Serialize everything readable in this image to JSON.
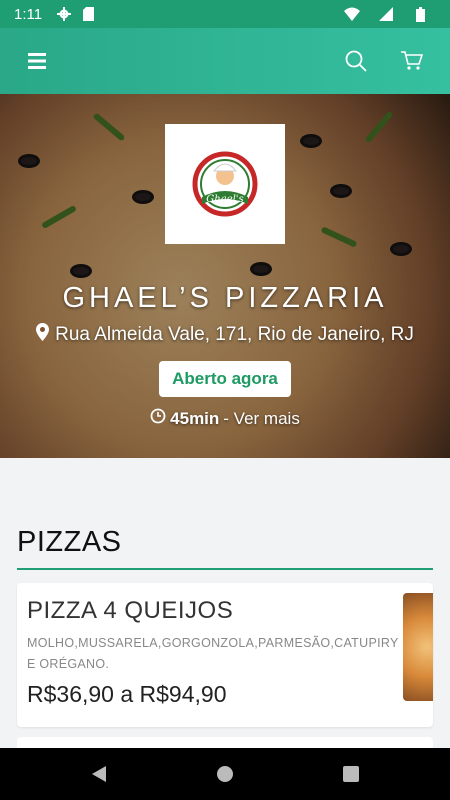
{
  "status_bar": {
    "time": "1:11",
    "icons": [
      "gear-icon",
      "sd-card-icon",
      "wifi-icon",
      "signal-icon",
      "battery-icon"
    ]
  },
  "toolbar": {
    "menu_icon": "hamburger-icon",
    "search_icon": "search-icon",
    "cart_icon": "cart-icon",
    "color_start": "#2aa888",
    "color_end": "#35c0a0"
  },
  "restaurant": {
    "logo_text_top": "PIZZARIA DELIVERY",
    "logo_text_main": "Ghael's",
    "name": "GHAEL’S PIZZARIA",
    "address": "Rua Almeida Vale, 171, Rio de Janeiro, RJ",
    "status": "Aberto agora",
    "delivery_time": "45min",
    "more_label": " - Ver mais",
    "status_color": "#1e9a63"
  },
  "menu": {
    "section_title": "PIZZAS",
    "items": [
      {
        "name": "PIZZA 4 QUEIJOS",
        "description": "MOLHO,MUSSARELA,GORGONZOLA,PARMESÃO,CATUPIRY E ORÉGANO.",
        "price": "R$36,90 a R$94,90"
      }
    ]
  },
  "accent_color": "#1f9d73"
}
